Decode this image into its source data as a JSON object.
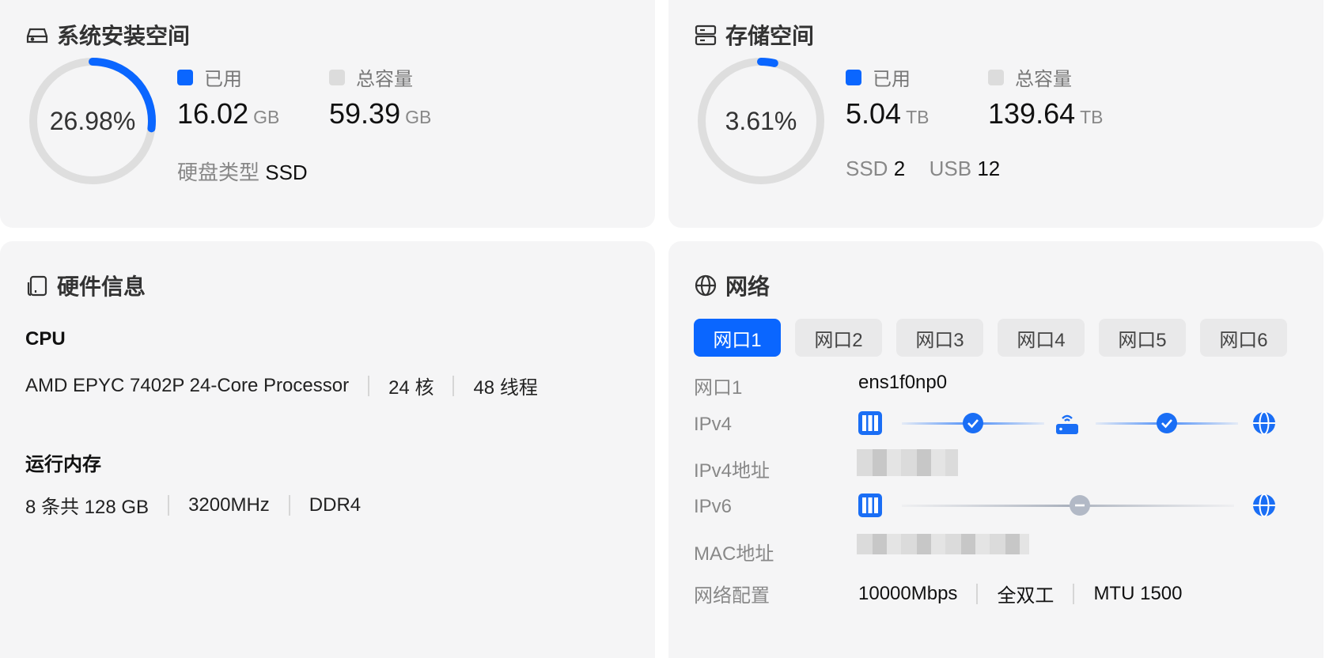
{
  "system": {
    "title": "系统安装空间",
    "percent": "26.98%",
    "percent_value": 0.2698,
    "used_legend": "已用",
    "used_value": "16.02",
    "used_unit": "GB",
    "total_legend": "总容量",
    "total_value": "59.39",
    "total_unit": "GB",
    "disk_type_label": "硬盘类型",
    "disk_type_value": "SSD",
    "accent": "#0a66ff",
    "track": "#dedede"
  },
  "storage": {
    "title": "存储空间",
    "percent": "3.61%",
    "percent_value": 0.0361,
    "used_legend": "已用",
    "used_value": "5.04",
    "used_unit": "TB",
    "total_legend": "总容量",
    "total_value": "139.64",
    "total_unit": "TB",
    "ssd_label": "SSD",
    "ssd_count": "2",
    "usb_label": "USB",
    "usb_count": "12"
  },
  "hardware": {
    "title": "硬件信息",
    "cpu_label": "CPU",
    "cpu_model": "AMD EPYC 7402P 24-Core Processor",
    "cpu_cores": "24 核",
    "cpu_threads": "48 线程",
    "mem_label": "运行内存",
    "mem_size": "8 条共 128 GB",
    "mem_freq": "3200MHz",
    "mem_type": "DDR4"
  },
  "network": {
    "title": "网络",
    "tabs": [
      "网口1",
      "网口2",
      "网口3",
      "网口4",
      "网口5",
      "网口6"
    ],
    "active_tab": 0,
    "port_label": "网口1",
    "port_value": "ens1f0np0",
    "ipv4_label": "IPv4",
    "ipv4_addr_label": "IPv4地址",
    "ipv6_label": "IPv6",
    "mac_label": "MAC地址",
    "config_label": "网络配置",
    "config_speed": "10000Mbps",
    "config_duplex": "全双工",
    "config_mtu": "MTU 1500",
    "icons": [
      "server-icon",
      "check-circle-icon",
      "router-icon",
      "globe-icon",
      "minus-circle-icon"
    ]
  }
}
